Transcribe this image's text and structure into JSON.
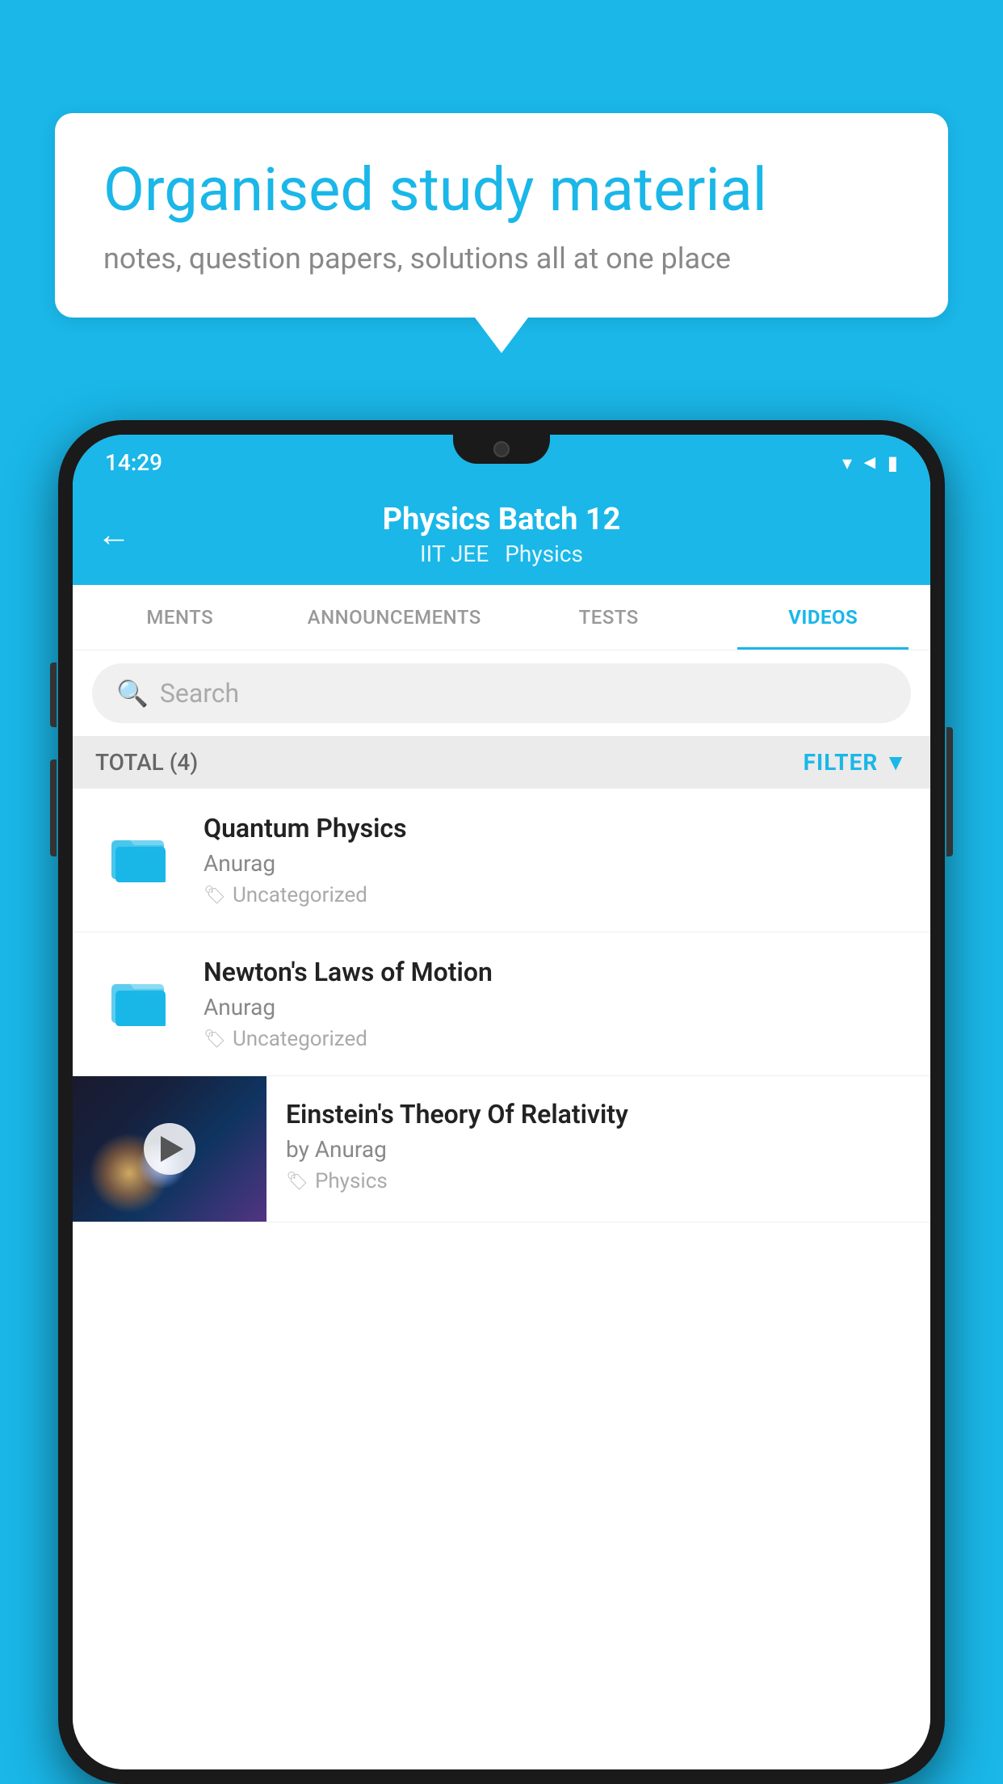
{
  "background": {
    "color": "#1ab7e8"
  },
  "bubble": {
    "title": "Organised study material",
    "subtitle": "notes, question papers, solutions all at one place"
  },
  "status_bar": {
    "time": "14:29",
    "icons": [
      "wifi",
      "signal",
      "battery"
    ]
  },
  "app_header": {
    "back_label": "←",
    "title": "Physics Batch 12",
    "tag1": "IIT JEE",
    "tag2": "Physics"
  },
  "tabs": [
    {
      "label": "MENTS",
      "active": false
    },
    {
      "label": "ANNOUNCEMENTS",
      "active": false
    },
    {
      "label": "TESTS",
      "active": false
    },
    {
      "label": "VIDEOS",
      "active": true
    }
  ],
  "search": {
    "placeholder": "Search"
  },
  "filter_bar": {
    "total_label": "TOTAL (4)",
    "filter_label": "FILTER"
  },
  "video_items": [
    {
      "title": "Quantum Physics",
      "author": "Anurag",
      "tag": "Uncategorized",
      "type": "folder"
    },
    {
      "title": "Newton's Laws of Motion",
      "author": "Anurag",
      "tag": "Uncategorized",
      "type": "folder"
    },
    {
      "title": "Einstein's Theory Of Relativity",
      "author": "by Anurag",
      "tag": "Physics",
      "type": "video"
    }
  ]
}
